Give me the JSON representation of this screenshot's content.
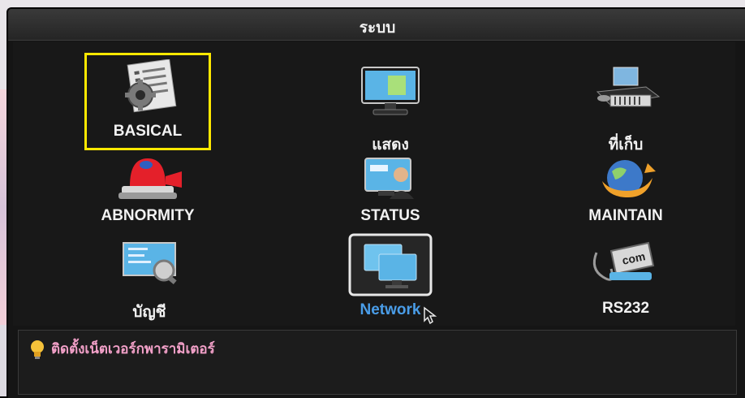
{
  "window": {
    "title": "ระบบ"
  },
  "menu": {
    "items": [
      {
        "label": "BASICAL",
        "icon": "settings-document-icon"
      },
      {
        "label": "แสดง",
        "icon": "monitor-display-icon"
      },
      {
        "label": "ที่เก็บ",
        "icon": "storage-disk-icon"
      },
      {
        "label": "ABNORMITY",
        "icon": "alarm-siren-icon"
      },
      {
        "label": "STATUS",
        "icon": "status-user-screen-icon"
      },
      {
        "label": "MAINTAIN",
        "icon": "maintain-globe-icon"
      },
      {
        "label": "บัญชี",
        "icon": "account-magnifier-icon"
      },
      {
        "label": "Network",
        "icon": "network-monitors-icon"
      },
      {
        "label": "RS232",
        "icon": "rs232-com-connector-icon"
      }
    ],
    "selected_label": "BASICAL",
    "hovered_label": "Network"
  },
  "info": {
    "text": "ติดตั้งเน็ตเวอร์กพารามิเตอร์",
    "icon": "lightbulb-icon"
  },
  "colors": {
    "highlight": "#ffe800",
    "hover_label": "#4a9de8",
    "info_text": "#f2a0c8"
  }
}
